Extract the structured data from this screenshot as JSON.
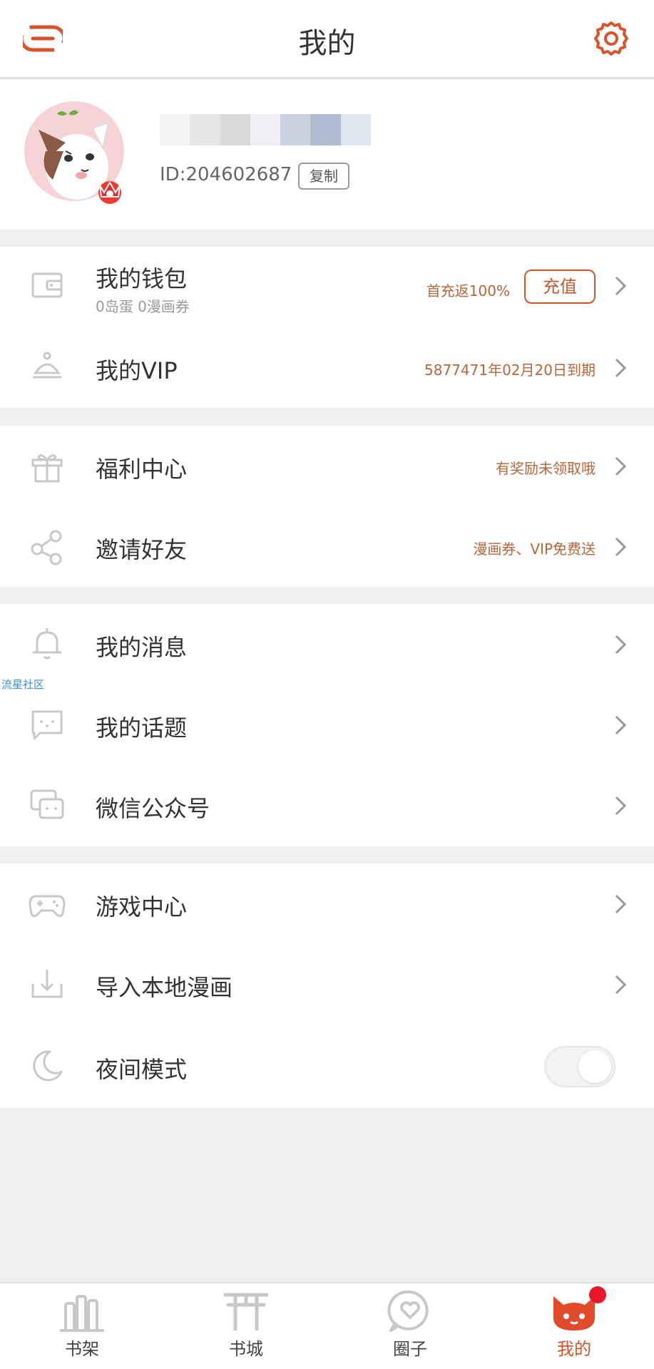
{
  "header": {
    "title": "我的",
    "menu_icon": "menu-icon",
    "settings_icon": "gear-icon"
  },
  "profile": {
    "id_text": "ID:204602687",
    "copy_label": "复制",
    "avatar": "cat-avatar",
    "badge_icon": "crown-icon"
  },
  "sections": {
    "wallet": {
      "label": "我的钱包",
      "sub": "0岛蛋 0漫画券",
      "promo": "首充返100%",
      "button": "充值"
    },
    "vip": {
      "label": "我的VIP",
      "expiry": "5877471年02月20日到期"
    },
    "welfare": {
      "label": "福利中心",
      "hint": "有奖励未领取哦"
    },
    "invite": {
      "label": "邀请好友",
      "hint": "漫画券、VIP免费送"
    },
    "messages": {
      "label": "我的消息"
    },
    "topics": {
      "label": "我的话题"
    },
    "wechat": {
      "label": "微信公众号"
    },
    "games": {
      "label": "游戏中心"
    },
    "import": {
      "label": "导入本地漫画"
    },
    "night": {
      "label": "夜间模式",
      "enabled": false
    }
  },
  "watermark": "流星社区",
  "tabs": [
    {
      "label": "书架",
      "icon": "bookshelf-icon",
      "active": false
    },
    {
      "label": "书城",
      "icon": "bookstore-icon",
      "active": false
    },
    {
      "label": "圈子",
      "icon": "circle-icon",
      "active": false
    },
    {
      "label": "我的",
      "icon": "cat-profile-icon",
      "active": true,
      "badge": true
    }
  ],
  "colors": {
    "accent": "#d9532b",
    "promo_text": "#b8653a",
    "badge": "#e8182b",
    "background": "#f0f0f0"
  }
}
